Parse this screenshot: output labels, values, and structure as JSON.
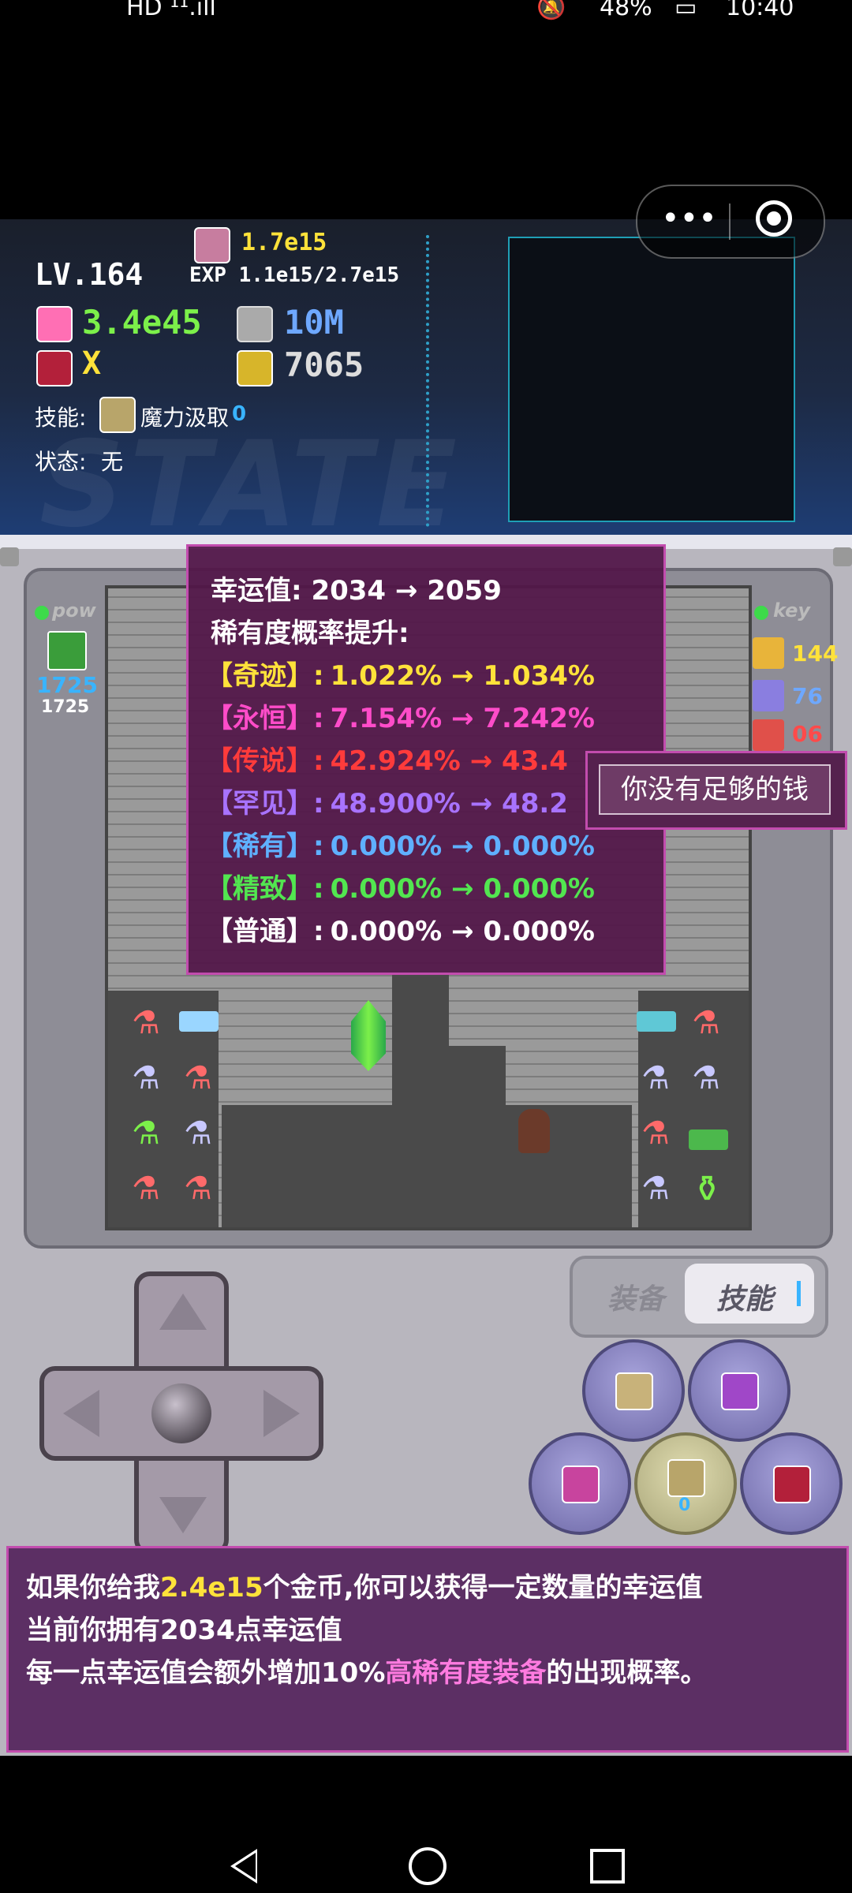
{
  "status_bar": {
    "left": "HD ¹¹.ıll",
    "battery": "48%",
    "time": "10:40"
  },
  "hud": {
    "level": "LV.164",
    "exp": "EXP 1.1e15/2.7e15",
    "gold": "1.7e15",
    "hp": "3.4e45",
    "mana": "10M",
    "attack": "X",
    "defense": "7065",
    "skill_label": "技能:",
    "skill_name": "魔力汲取",
    "skill_level": "0",
    "state_label": "状态:",
    "state_value": "无",
    "watermark": "STATE"
  },
  "left_panel": {
    "label": "pow",
    "value1": "1725",
    "value2": "1725"
  },
  "right_panel": {
    "label": "key",
    "yellow": "144",
    "blue": "76",
    "red": "06"
  },
  "tooltip": {
    "luck_label": "幸运值:",
    "luck_change": "2034 → 2059",
    "rarity_title": "稀有度概率提升:",
    "rows": [
      {
        "name": "【奇迹】:",
        "value": "1.022% → 1.034%",
        "color": "#ffe23a"
      },
      {
        "name": "【永恒】:",
        "value": "7.154% → 7.242%",
        "color": "#ff4cc9"
      },
      {
        "name": "【传说】:",
        "value": "42.924% → 43.4",
        "color": "#ff3b3b"
      },
      {
        "name": "【罕见】:",
        "value": "48.900% → 48.2",
        "color": "#a873ff"
      },
      {
        "name": "【稀有】:",
        "value": "0.000% → 0.000%",
        "color": "#5fb0ff"
      },
      {
        "name": "【精致】:",
        "value": "0.000% → 0.000%",
        "color": "#52e650"
      },
      {
        "name": "【普通】:",
        "value": "0.000% → 0.000%",
        "color": "#ffffff"
      }
    ]
  },
  "notice": "你没有足够的钱",
  "tabs": {
    "equip": "装备",
    "skill": "技能"
  },
  "skill_button_level": "0",
  "dialog": {
    "line1_a": "如果你给我",
    "line1_gold": "2.4e15",
    "line1_b": "个金币,你可以获得一定数量的幸运值",
    "line2_a": "当前你拥有",
    "line2_luck": "2034",
    "line2_b": "点幸运值",
    "line3_a": "每一点幸运值会额外增加",
    "line3_pct": "10%",
    "line3_hl": "高稀有度装备",
    "line3_b": "的出现概率。"
  },
  "colors": {
    "hp": "#7cf04a",
    "mana": "#6ea8ff",
    "gold": "#ffe23a",
    "highlight": "#ff7be0",
    "accent": "#c24cae"
  }
}
